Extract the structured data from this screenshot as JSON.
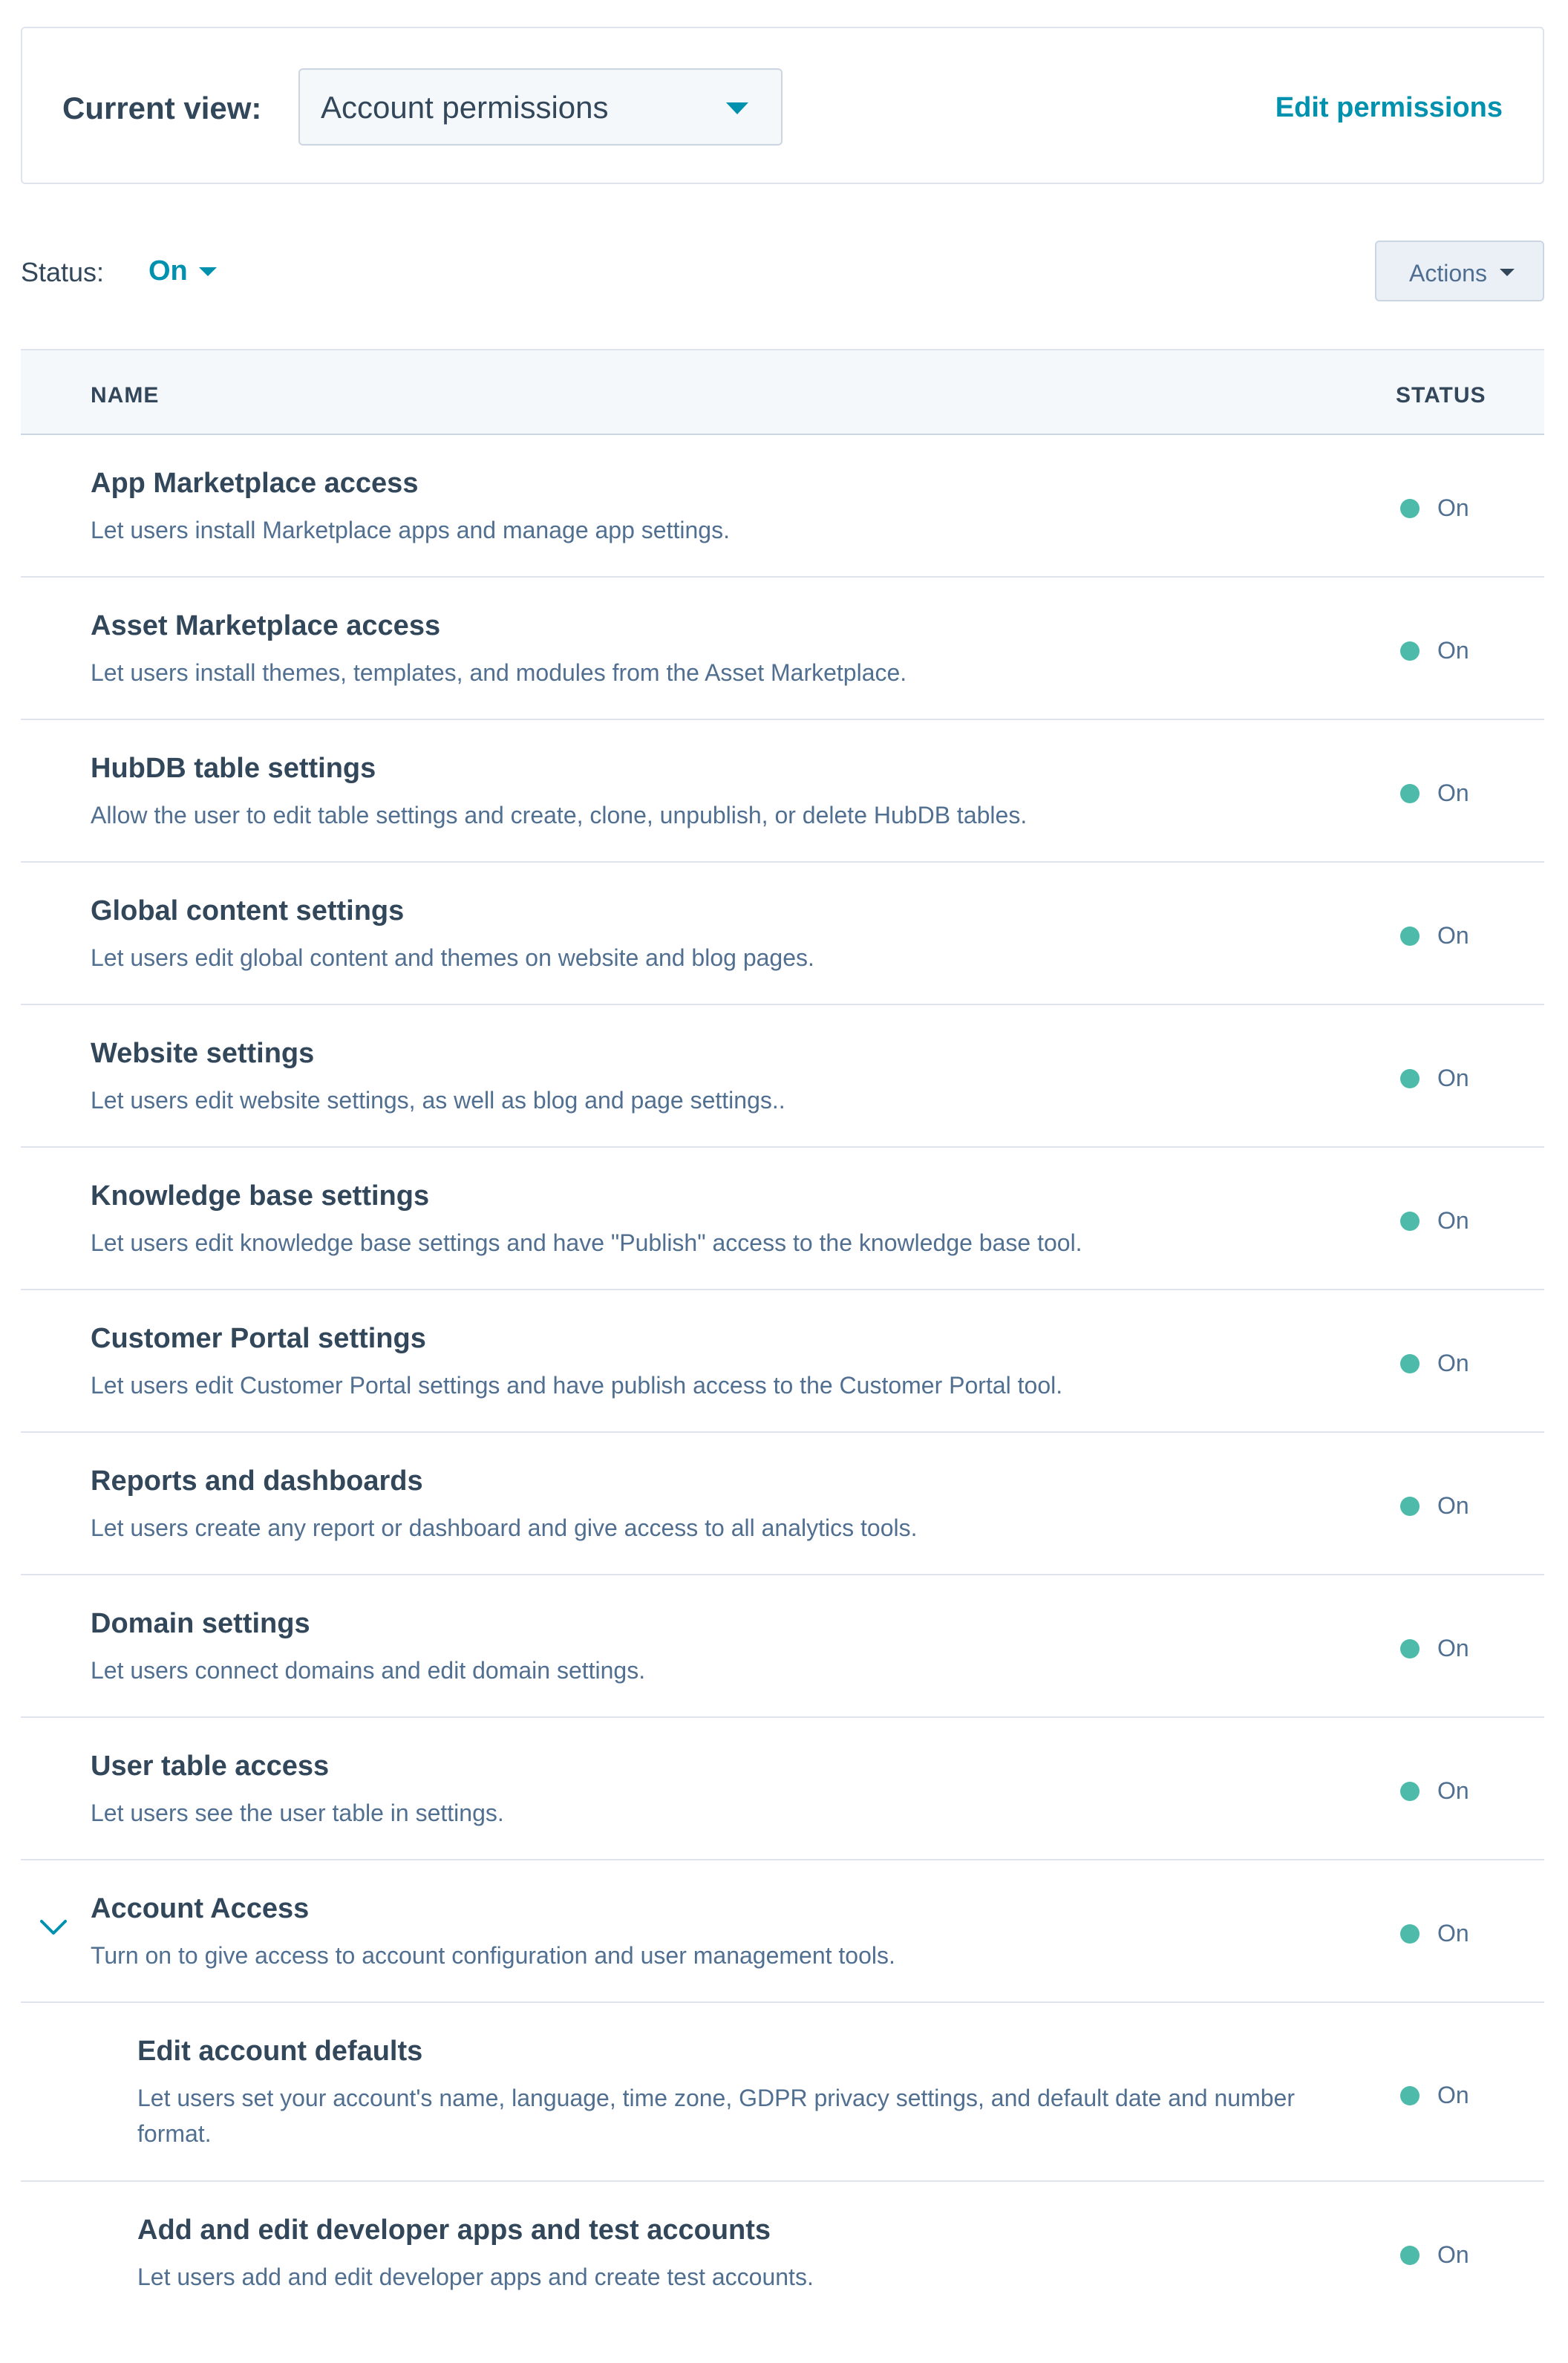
{
  "view": {
    "label": "Current view:",
    "selected": "Account permissions",
    "edit_link": "Edit permissions"
  },
  "filter": {
    "label": "Status:",
    "value": "On"
  },
  "actions": {
    "label": "Actions"
  },
  "table": {
    "col_name": "NAME",
    "col_status": "STATUS",
    "rows": [
      {
        "title": "App Marketplace access",
        "desc": "Let users install Marketplace apps and manage app settings.",
        "status": "On"
      },
      {
        "title": "Asset Marketplace access",
        "desc": "Let users install themes, templates, and modules from the Asset Marketplace.",
        "status": "On"
      },
      {
        "title": "HubDB table settings",
        "desc": "Allow the user to edit table settings and create, clone, unpublish, or delete HubDB tables.",
        "status": "On"
      },
      {
        "title": "Global content settings",
        "desc": "Let users edit global content and themes on website and blog pages.",
        "status": "On"
      },
      {
        "title": "Website settings",
        "desc": "Let users edit website settings, as well as blog and page settings..",
        "status": "On"
      },
      {
        "title": "Knowledge base settings",
        "desc": "Let users edit knowledge base settings and have \"Publish\" access to the knowledge base tool.",
        "status": "On"
      },
      {
        "title": "Customer Portal settings",
        "desc": "Let users edit Customer Portal settings and have publish access to the Customer Portal tool.",
        "status": "On"
      },
      {
        "title": "Reports and dashboards",
        "desc": "Let users create any report or dashboard and give access to all analytics tools.",
        "status": "On"
      },
      {
        "title": "Domain settings",
        "desc": "Let users connect domains and edit domain settings.",
        "status": "On"
      },
      {
        "title": "User table access",
        "desc": "Let users see the user table in settings.",
        "status": "On"
      },
      {
        "title": "Account Access",
        "desc": "Turn on to give access to account configuration and user management tools.",
        "status": "On"
      },
      {
        "title": "Edit account defaults",
        "desc": "Let users set your account's name, language, time zone, GDPR privacy settings, and default date and number format.",
        "status": "On"
      },
      {
        "title": "Add and edit developer apps and test accounts",
        "desc": "Let users add and edit developer apps and create test accounts.",
        "status": "On"
      }
    ]
  }
}
